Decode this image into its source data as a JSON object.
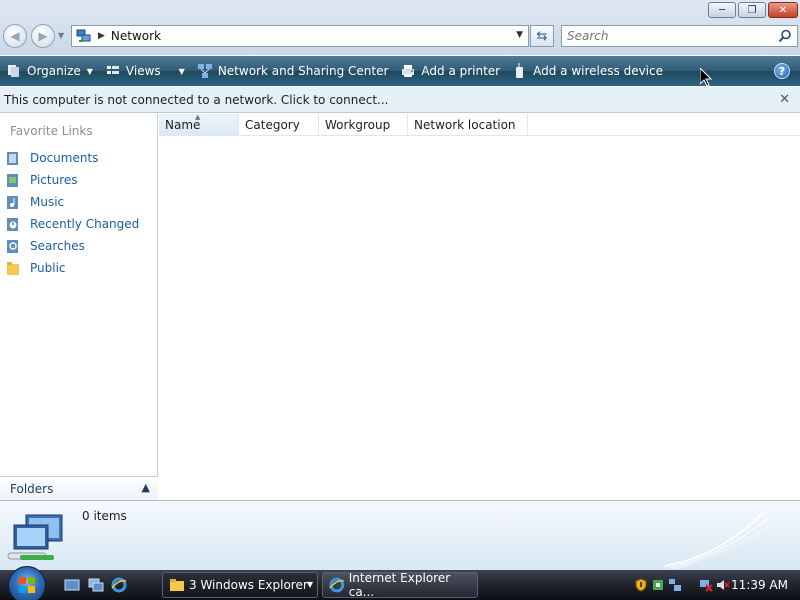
{
  "window": {
    "address": {
      "crumb": "Network"
    },
    "search": {
      "placeholder": "Search"
    }
  },
  "toolbar": {
    "items": [
      {
        "label": "Organize",
        "icon": "organize-icon",
        "has_dropdown": true
      },
      {
        "label": "Views",
        "icon": "views-icon",
        "has_dropdown": true
      },
      {
        "label": "Network and Sharing Center",
        "icon": "network-sharing-icon",
        "has_dropdown": false
      },
      {
        "label": "Add a printer",
        "icon": "printer-icon",
        "has_dropdown": false
      },
      {
        "label": "Add a wireless device",
        "icon": "wireless-device-icon",
        "has_dropdown": false
      }
    ]
  },
  "infobar": {
    "message": "This computer is not connected to a network. Click to connect..."
  },
  "navpane": {
    "header": "Favorite Links",
    "links": [
      {
        "label": "Documents",
        "icon": "documents-icon"
      },
      {
        "label": "Pictures",
        "icon": "pictures-icon"
      },
      {
        "label": "Music",
        "icon": "music-icon"
      },
      {
        "label": "Recently Changed",
        "icon": "recently-changed-icon"
      },
      {
        "label": "Searches",
        "icon": "searches-icon"
      },
      {
        "label": "Public",
        "icon": "public-folder-icon"
      }
    ],
    "folders_label": "Folders"
  },
  "columns": [
    "Name",
    "Category",
    "Workgroup",
    "Network location"
  ],
  "details": {
    "item_count": "0 items"
  },
  "taskbar": {
    "tasks": [
      {
        "label": "3 Windows Explorer"
      },
      {
        "label": "Internet Explorer ca..."
      }
    ],
    "clock": "11:39 AM"
  },
  "colors": {
    "commandbar": "#2f5b73",
    "link": "#1a5fa4",
    "infobar": "#e5f0f8"
  }
}
